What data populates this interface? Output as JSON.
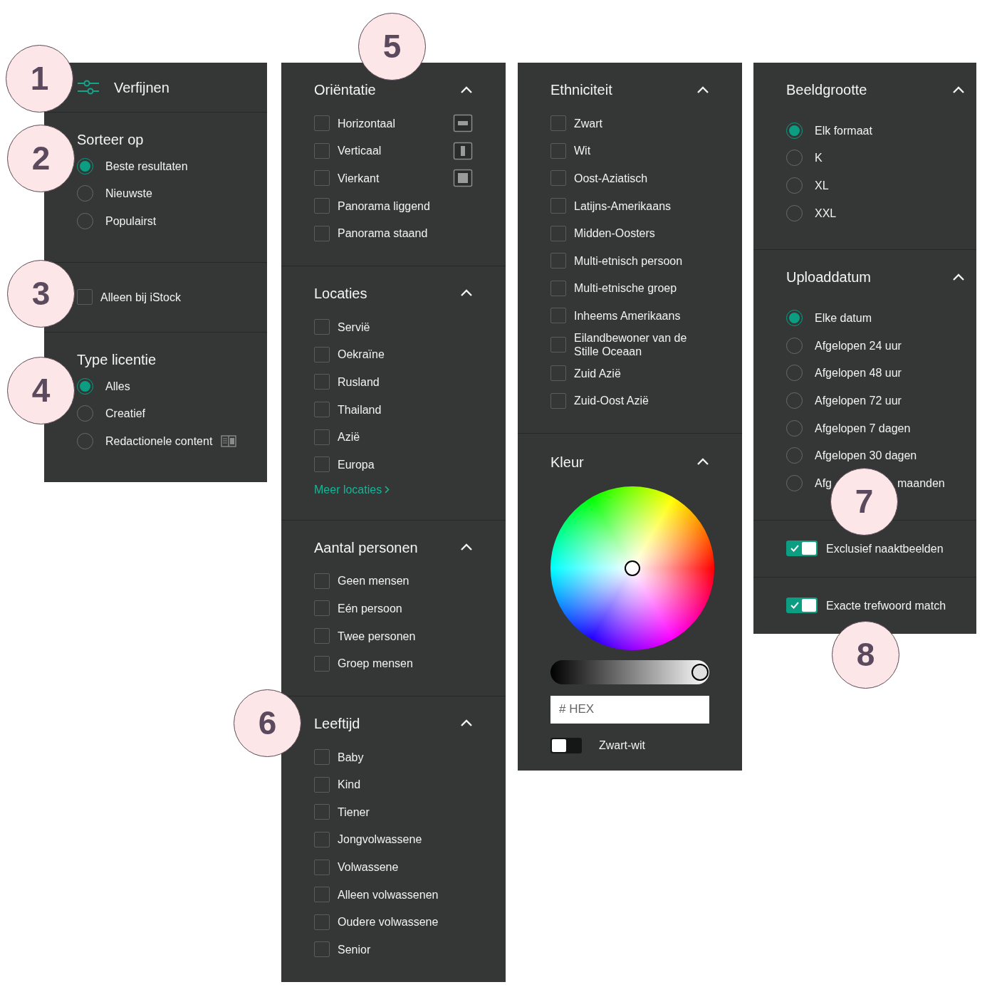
{
  "callouts": [
    {
      "number": "1"
    },
    {
      "number": "2"
    },
    {
      "number": "3"
    },
    {
      "number": "4"
    },
    {
      "number": "5"
    },
    {
      "number": "6"
    },
    {
      "number": "7"
    },
    {
      "number": "8"
    }
  ],
  "columns": [
    {
      "sections": [
        {
          "kind": "header",
          "title": "Verfijnen"
        },
        {
          "kind": "radio_group",
          "title": "Sorteer op",
          "options": [
            {
              "label": "Beste resultaten",
              "selected": true
            },
            {
              "label": "Nieuwste",
              "selected": false
            },
            {
              "label": "Populairst",
              "selected": false
            }
          ]
        },
        {
          "kind": "checkbox",
          "label": "Alleen bij iStock",
          "checked": false
        },
        {
          "kind": "radio_group",
          "title": "Type licentie",
          "options": [
            {
              "label": "Alles",
              "selected": true
            },
            {
              "label": "Creatief",
              "selected": false
            },
            {
              "label": "Redactionele content",
              "selected": false,
              "kind": "editorial"
            }
          ]
        }
      ]
    },
    {
      "sections": [
        {
          "kind": "checkbox_group",
          "title": "Oriëntatie",
          "expanded": true,
          "options": [
            {
              "label": "Horizontaal",
              "checked": false,
              "kind": "horizontal"
            },
            {
              "label": "Verticaal",
              "checked": false,
              "kind": "vertical"
            },
            {
              "label": "Vierkant",
              "checked": false,
              "kind": "square"
            },
            {
              "label": "Panorama liggend",
              "checked": false
            },
            {
              "label": "Panorama staand",
              "checked": false
            }
          ]
        },
        {
          "kind": "checkbox_group",
          "title": "Locaties",
          "expanded": true,
          "options": [
            {
              "label": "Servië",
              "checked": false
            },
            {
              "label": "Oekraïne",
              "checked": false
            },
            {
              "label": "Rusland",
              "checked": false
            },
            {
              "label": "Thailand",
              "checked": false
            },
            {
              "label": "Azië",
              "checked": false
            },
            {
              "label": "Europa",
              "checked": false
            }
          ],
          "link": "Meer locaties"
        },
        {
          "kind": "checkbox_group",
          "title": "Aantal personen",
          "expanded": true,
          "options": [
            {
              "label": "Geen mensen",
              "checked": false
            },
            {
              "label": "Eén persoon",
              "checked": false
            },
            {
              "label": "Twee personen",
              "checked": false
            },
            {
              "label": "Groep mensen",
              "checked": false
            }
          ]
        },
        {
          "kind": "checkbox_group",
          "title": "Leeftijd",
          "expanded": true,
          "options": [
            {
              "label": "Baby",
              "checked": false
            },
            {
              "label": "Kind",
              "checked": false
            },
            {
              "label": "Tiener",
              "checked": false
            },
            {
              "label": "Jongvolwassene",
              "checked": false
            },
            {
              "label": "Volwassene",
              "checked": false
            },
            {
              "label": "Alleen volwassenen",
              "checked": false
            },
            {
              "label": "Oudere volwassene",
              "checked": false
            },
            {
              "label": "Senior",
              "checked": false
            }
          ]
        }
      ]
    },
    {
      "sections": [
        {
          "kind": "checkbox_group",
          "title": "Ethniciteit",
          "expanded": true,
          "options": [
            {
              "label": "Zwart",
              "checked": false
            },
            {
              "label": "Wit",
              "checked": false
            },
            {
              "label": "Oost-Aziatisch",
              "checked": false
            },
            {
              "label": "Latijns-Amerikaans",
              "checked": false
            },
            {
              "label": "Midden-Oosters",
              "checked": false
            },
            {
              "label": "Multi-etnisch persoon",
              "checked": false
            },
            {
              "label": "Multi-etnische groep",
              "checked": false
            },
            {
              "label": "Inheems Amerikaans",
              "checked": false
            },
            {
              "label": "Eilandbewoner van de Stille Oceaan",
              "checked": false
            },
            {
              "label": "Zuid Azië",
              "checked": false
            },
            {
              "label": "Zuid-Oost Azië",
              "checked": false
            }
          ]
        },
        {
          "kind": "color",
          "title": "Kleur",
          "expanded": true,
          "brightness": {
            "level": 0.94
          },
          "hex": {
            "placeholder": "# HEX"
          },
          "bw_toggle": {
            "label": "Zwart-wit",
            "on": false
          }
        }
      ]
    },
    {
      "sections": [
        {
          "kind": "radio_group",
          "title": "Beeldgrootte",
          "expanded": true,
          "options": [
            {
              "label": "Elk formaat",
              "selected": true
            },
            {
              "label": "K",
              "selected": false
            },
            {
              "label": "XL",
              "selected": false
            },
            {
              "label": "XXL",
              "selected": false
            }
          ]
        },
        {
          "kind": "radio_group",
          "title": "Uploaddatum",
          "expanded": true,
          "options": [
            {
              "label": "Elke datum",
              "selected": true
            },
            {
              "label": "Afgelopen 24 uur",
              "selected": false
            },
            {
              "label": "Afgelopen 48 uur",
              "selected": false
            },
            {
              "label": "Afgelopen 72 uur",
              "selected": false
            },
            {
              "label": "Afgelopen 7 dagen",
              "selected": false
            },
            {
              "label": "Afgelopen 30 dagen",
              "selected": false
            },
            {
              "label_start": "Afg",
              "label_end": "maanden",
              "selected": false
            }
          ]
        },
        {
          "kind": "toggle",
          "label": "Exclusief naaktbeelden",
          "on": true
        },
        {
          "kind": "toggle",
          "label": "Exacte trefwoord match",
          "on": true
        }
      ]
    }
  ]
}
